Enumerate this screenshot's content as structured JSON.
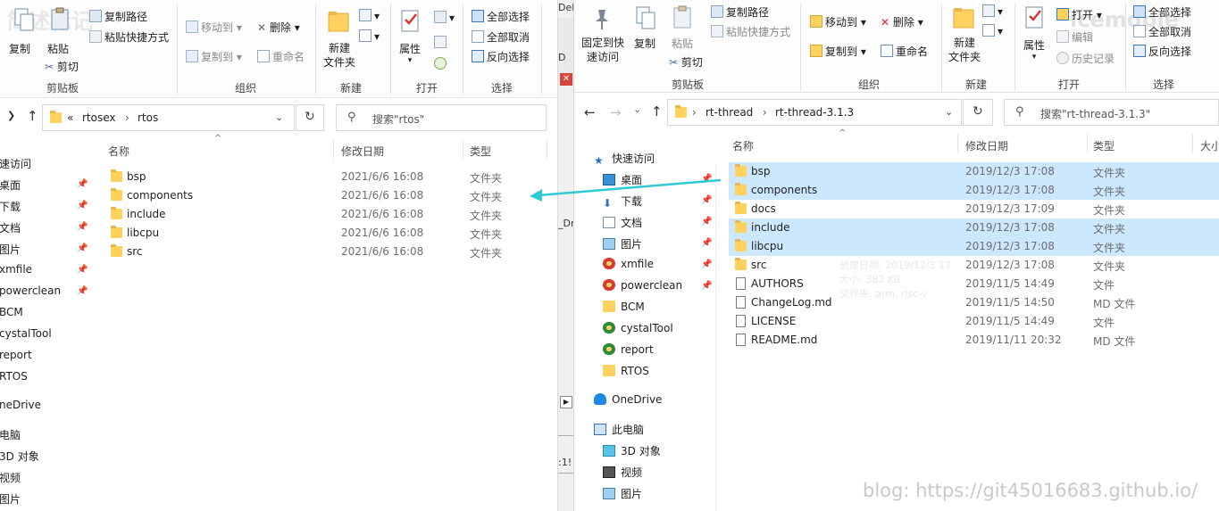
{
  "left": {
    "ribbon": {
      "clipboard": {
        "copy": "复制",
        "paste": "粘贴",
        "copy_path": "复制路径",
        "paste_shortcut": "粘贴快捷方式",
        "cut": "剪切",
        "group": "剪贴板"
      },
      "organize": {
        "move_to": "移动到",
        "copy_to": "复制到",
        "delete": "删除",
        "rename": "重命名",
        "group": "组织"
      },
      "new": {
        "new_folder_1": "新建",
        "new_folder_2": "文件夹",
        "group": "新建"
      },
      "open": {
        "properties": "属性",
        "group": "打开"
      },
      "select": {
        "select_all": "全部选择",
        "select_none": "全部取消",
        "invert": "反向选择",
        "group": "选择"
      }
    },
    "address": {
      "overflow": "«",
      "crumbs": [
        "rtosex",
        "rtos"
      ]
    },
    "search_placeholder": "搜索\"rtos\"",
    "columns": {
      "name": "名称",
      "date": "修改日期",
      "type": "类型"
    },
    "files": [
      {
        "name": "bsp",
        "date": "2021/6/6 16:08",
        "type": "文件夹"
      },
      {
        "name": "components",
        "date": "2021/6/6 16:08",
        "type": "文件夹"
      },
      {
        "name": "include",
        "date": "2021/6/6 16:08",
        "type": "文件夹"
      },
      {
        "name": "libcpu",
        "date": "2021/6/6 16:08",
        "type": "文件夹"
      },
      {
        "name": "src",
        "date": "2021/6/6 16:08",
        "type": "文件夹"
      }
    ],
    "nav": [
      "速访问",
      "桌面",
      "下载",
      "文档",
      "图片",
      "xmfile",
      "powerclean",
      "BCM",
      "cystalTool",
      "report",
      "RTOS",
      "neDrive",
      "电脑",
      "3D 对象",
      "视频",
      "图片"
    ],
    "pin": "📌"
  },
  "gap": {
    "texts": [
      "Debi",
      "D",
      "_Dr",
      ":1!"
    ]
  },
  "right": {
    "ribbon": {
      "clipboard": {
        "pin_quick_1": "固定到快",
        "pin_quick_2": "速访问",
        "copy": "复制",
        "paste": "粘贴",
        "copy_path": "复制路径",
        "paste_shortcut": "粘贴快捷方式",
        "cut": "剪切",
        "group": "剪贴板"
      },
      "organize": {
        "move_to": "移动到",
        "copy_to": "复制到",
        "delete": "删除",
        "rename": "重命名",
        "group": "组织"
      },
      "new": {
        "new_folder_1": "新建",
        "new_folder_2": "文件夹",
        "group": "新建"
      },
      "open": {
        "properties": "属性",
        "open": "打开",
        "edit": "编辑",
        "history": "历史记录",
        "group": "打开"
      },
      "select": {
        "select_all": "全部选择",
        "select_none": "全部取消",
        "invert": "反向选择",
        "group": "选择"
      }
    },
    "address": {
      "crumbs": [
        "rt-thread",
        "rt-thread-3.1.3"
      ]
    },
    "search_placeholder": "搜索\"rt-thread-3.1.3\"",
    "columns": {
      "name": "名称",
      "date": "修改日期",
      "type": "类型",
      "size": "大小"
    },
    "files": [
      {
        "name": "bsp",
        "date": "2019/12/3 17:08",
        "type": "文件夹",
        "kind": "folder",
        "selected": true
      },
      {
        "name": "components",
        "date": "2019/12/3 17:08",
        "type": "文件夹",
        "kind": "folder",
        "selected": true
      },
      {
        "name": "docs",
        "date": "2019/12/3 17:09",
        "type": "文件夹",
        "kind": "folder",
        "selected": false
      },
      {
        "name": "include",
        "date": "2019/12/3 17:08",
        "type": "文件夹",
        "kind": "folder",
        "selected": true
      },
      {
        "name": "libcpu",
        "date": "2019/12/3 17:08",
        "type": "文件夹",
        "kind": "folder",
        "selected": true
      },
      {
        "name": "src",
        "date": "2019/12/3 17:08",
        "type": "文件夹",
        "kind": "folder",
        "selected": false
      },
      {
        "name": "AUTHORS",
        "date": "2019/11/5 14:49",
        "type": "文件",
        "kind": "file",
        "selected": false
      },
      {
        "name": "ChangeLog.md",
        "date": "2019/11/5 14:50",
        "type": "MD 文件",
        "kind": "file",
        "selected": false
      },
      {
        "name": "LICENSE",
        "date": "2019/11/5 14:49",
        "type": "文件",
        "kind": "file",
        "selected": false
      },
      {
        "name": "README.md",
        "date": "2019/11/11 20:32",
        "type": "MD 文件",
        "kind": "file",
        "selected": false
      }
    ],
    "nav": [
      {
        "label": "快速访问",
        "icon": "star-icon",
        "pin": false
      },
      {
        "label": "桌面",
        "icon": "desktop-icon",
        "pin": true
      },
      {
        "label": "下载",
        "icon": "download-icon",
        "pin": true
      },
      {
        "label": "文档",
        "icon": "document-icon",
        "pin": true
      },
      {
        "label": "图片",
        "icon": "picture-icon",
        "pin": true
      },
      {
        "label": "xmfile",
        "icon": "sync-error-icon",
        "pin": true
      },
      {
        "label": "powerclean",
        "icon": "sync-error-icon",
        "pin": true
      },
      {
        "label": "BCM",
        "icon": "folder-icon",
        "pin": false
      },
      {
        "label": "cystalTool",
        "icon": "sync-ok-icon",
        "pin": false
      },
      {
        "label": "report",
        "icon": "sync-ok-icon",
        "pin": false
      },
      {
        "label": "RTOS",
        "icon": "folder-icon",
        "pin": false
      },
      {
        "label": "OneDrive",
        "icon": "cloud-icon",
        "pin": false
      },
      {
        "label": "此电脑",
        "icon": "computer-icon",
        "pin": false
      },
      {
        "label": "3D 对象",
        "icon": "cube-icon",
        "pin": false
      },
      {
        "label": "视频",
        "icon": "video-icon",
        "pin": false
      },
      {
        "label": "图片",
        "icon": "picture-icon",
        "pin": false
      }
    ],
    "tooltip": [
      "创建日期: 2019/12/3 17",
      "大小: 382 KB",
      "文件夹: arm, risc-v"
    ]
  },
  "watermark": "blog: https://git45016683.github.io/",
  "watermark_top_left": "简述标记",
  "watermark_top_right": "icemople",
  "colors": {
    "selection": "#cce8ff",
    "arrow": "#2fc9d4",
    "folder": "#ffd25f",
    "accent": "#0078d7"
  }
}
